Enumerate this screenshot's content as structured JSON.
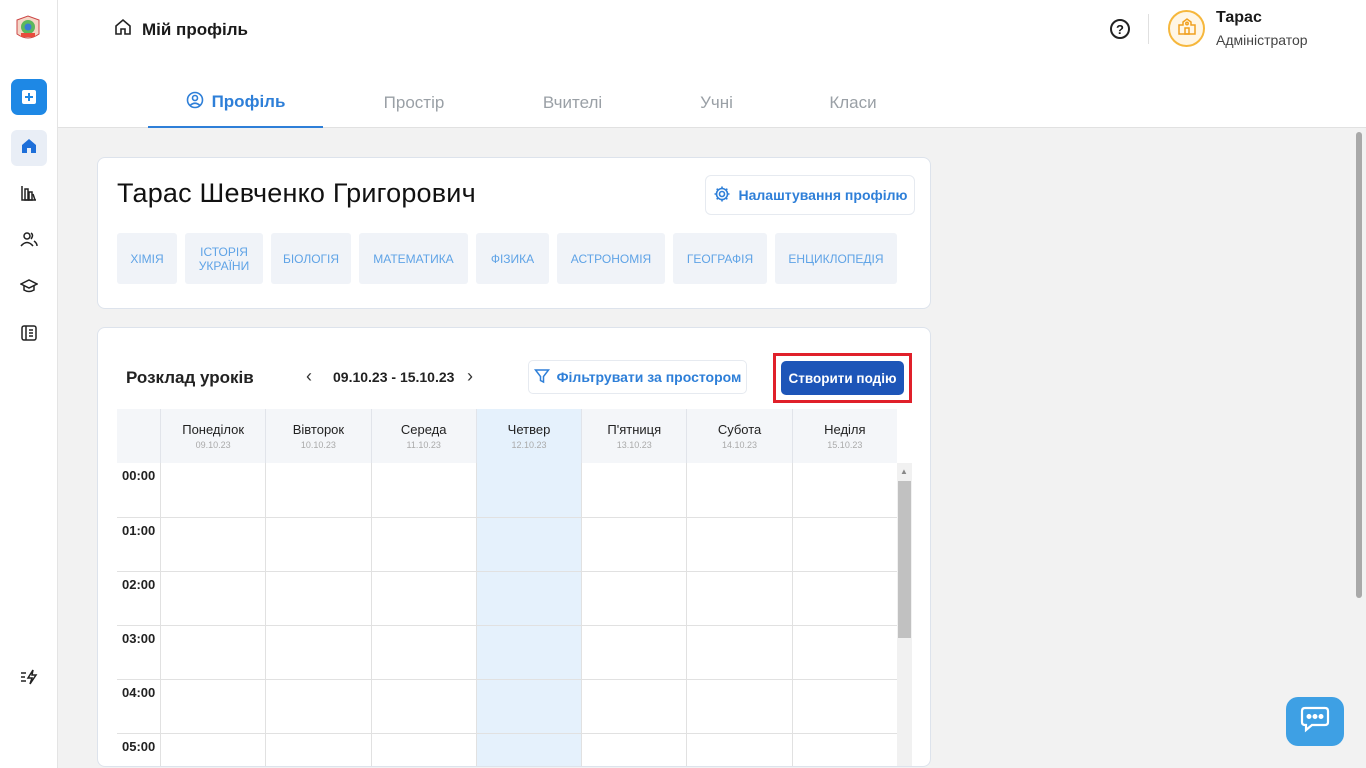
{
  "sidebar": {
    "items": [
      {
        "icon": "add-icon"
      },
      {
        "icon": "home-icon"
      },
      {
        "icon": "bar-chart-icon"
      },
      {
        "icon": "users-icon"
      },
      {
        "icon": "graduation-cap-icon"
      },
      {
        "icon": "book-icon"
      },
      {
        "icon": "zap-list-icon"
      }
    ]
  },
  "header": {
    "breadcrumb": "Мій профіль",
    "user": {
      "name": "Тарас",
      "role": "Адміністратор"
    },
    "tabs": [
      "Профіль",
      "Простір",
      "Вчителі",
      "Учні",
      "Класи"
    ],
    "active_tab": "Профіль"
  },
  "profile": {
    "full_name": "Тарас Шевченко Григорович",
    "settings_label": "Налаштування профілю",
    "subjects": [
      "ХІМІЯ",
      "ІСТОРІЯ УКРАЇНИ",
      "БІОЛОГІЯ",
      "МАТЕМАТИКА",
      "ФІЗИКА",
      "АСТРОНОМІЯ",
      "ГЕОГРАФІЯ",
      "ЕНЦИКЛОПЕДІЯ"
    ]
  },
  "schedule": {
    "title": "Розклад уроків",
    "prev": "‹",
    "next": "›",
    "date_range": "09.10.23 - 15.10.23",
    "filter_label": "Фільтрувати за простором",
    "create_label": "Створити подію",
    "days": [
      {
        "name": "Понеділок",
        "date": "09.10.23"
      },
      {
        "name": "Вівторок",
        "date": "10.10.23"
      },
      {
        "name": "Середа",
        "date": "11.10.23"
      },
      {
        "name": "Четвер",
        "date": "12.10.23"
      },
      {
        "name": "П'ятниця",
        "date": "13.10.23"
      },
      {
        "name": "Субота",
        "date": "14.10.23"
      },
      {
        "name": "Неділя",
        "date": "15.10.23"
      }
    ],
    "today_index": 3,
    "hours": [
      "00:00",
      "01:00",
      "02:00",
      "03:00",
      "04:00",
      "05:00"
    ]
  },
  "colors": {
    "accent": "#2e7fd8",
    "create_button": "#1d55b8",
    "highlight": "#e0202a",
    "today_bg": "#e5f1fc"
  }
}
